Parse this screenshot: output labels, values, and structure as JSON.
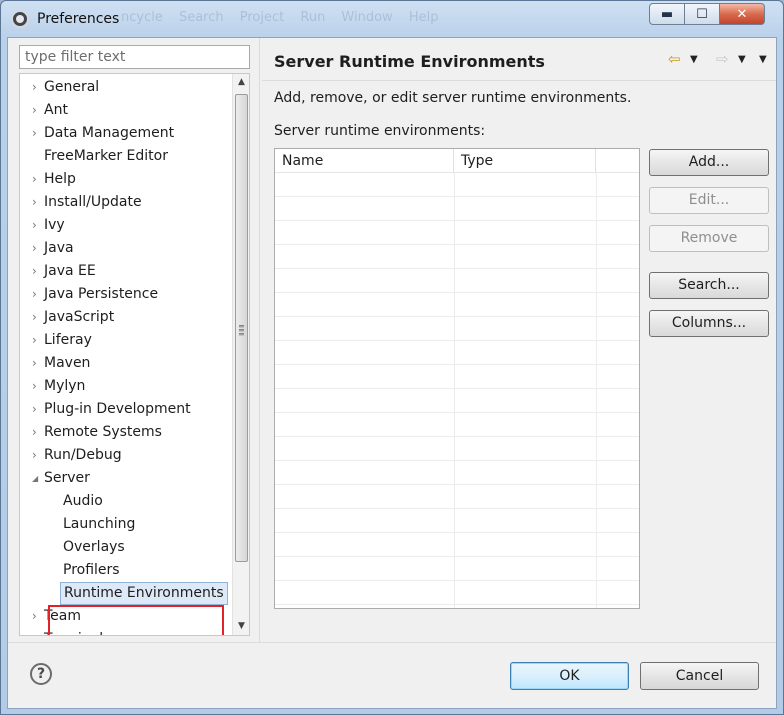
{
  "window": {
    "title": "Preferences",
    "minimize_glyph": "▬",
    "maximize_glyph": "☐",
    "close_glyph": "✕",
    "background_menu": "ncycle   Search   Project   Run   Window   Help"
  },
  "filter": {
    "placeholder": "type filter text",
    "value": ""
  },
  "tree": {
    "items": [
      {
        "label": "General",
        "expander": "›"
      },
      {
        "label": "Ant",
        "expander": "›"
      },
      {
        "label": "Data Management",
        "expander": "›"
      },
      {
        "label": "FreeMarker Editor",
        "expander": ""
      },
      {
        "label": "Help",
        "expander": "›"
      },
      {
        "label": "Install/Update",
        "expander": "›"
      },
      {
        "label": "Ivy",
        "expander": "›"
      },
      {
        "label": "Java",
        "expander": "›"
      },
      {
        "label": "Java EE",
        "expander": "›"
      },
      {
        "label": "Java Persistence",
        "expander": "›"
      },
      {
        "label": "JavaScript",
        "expander": "›"
      },
      {
        "label": "Liferay",
        "expander": "›"
      },
      {
        "label": "Maven",
        "expander": "›"
      },
      {
        "label": "Mylyn",
        "expander": "›"
      },
      {
        "label": "Plug-in Development",
        "expander": "›"
      },
      {
        "label": "Remote Systems",
        "expander": "›"
      },
      {
        "label": "Run/Debug",
        "expander": "›"
      },
      {
        "label": "Server",
        "expander": "◢"
      },
      {
        "label": "Audio",
        "expander": ""
      },
      {
        "label": "Launching",
        "expander": ""
      },
      {
        "label": "Overlays",
        "expander": ""
      },
      {
        "label": "Profilers",
        "expander": ""
      },
      {
        "label": "Runtime Environments",
        "expander": ""
      },
      {
        "label": "Team",
        "expander": "›"
      },
      {
        "label": "Terminal",
        "expander": ""
      }
    ],
    "selected": "Runtime Environments"
  },
  "page": {
    "title": "Server Runtime Environments",
    "description": "Add, remove, or edit server runtime environments.",
    "table_label": "Server runtime environments:",
    "columns": [
      "Name",
      "Type",
      ""
    ],
    "rows": []
  },
  "buttons": {
    "add": "Add...",
    "edit": "Edit...",
    "remove": "Remove",
    "search": "Search...",
    "columns": "Columns..."
  },
  "history": {
    "back_glyph": "⇦",
    "forward_glyph": "⇨",
    "dropdown_glyph": "▼"
  },
  "footer": {
    "help_glyph": "?",
    "ok": "OK",
    "cancel": "Cancel"
  },
  "colors": {
    "selection": "#dde9f6",
    "highlight_box": "#e32227",
    "default_button_border": "#3c7fb1"
  }
}
